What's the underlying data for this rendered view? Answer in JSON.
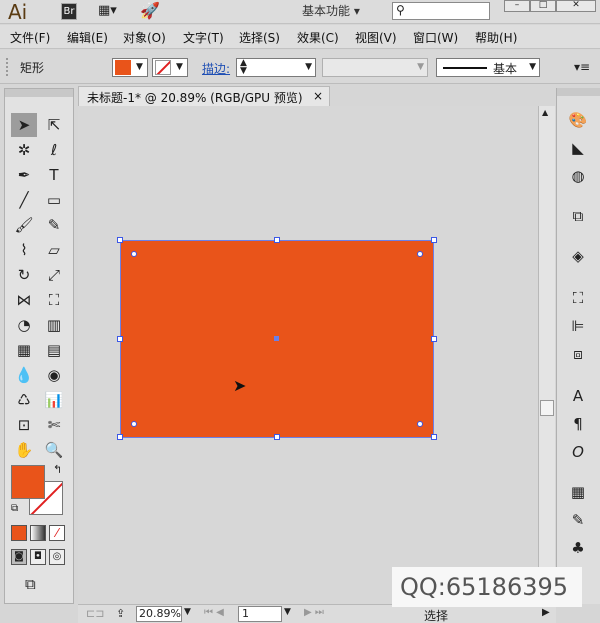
{
  "app": {
    "logo": "Ai",
    "br_label": "Br",
    "workspace": "基本功能 ▾"
  },
  "menu": [
    "文件(F)",
    "编辑(E)",
    "对象(O)",
    "文字(T)",
    "选择(S)",
    "效果(C)",
    "视图(V)",
    "窗口(W)",
    "帮助(H)"
  ],
  "control": {
    "tool_name": "矩形",
    "stroke_label": "描边:",
    "style_label": "基本",
    "fill_color": "#e9541a"
  },
  "document": {
    "tab_title": "未标题-1* @ 20.89% (RGB/GPU 预览)",
    "close_icon": "×"
  },
  "status": {
    "zoom": "20.89%",
    "page": "1",
    "mode": "选择"
  },
  "watermark": "QQ:65186395",
  "colors": {
    "shape_fill": "#e9541a",
    "selection": "#3c58e6"
  }
}
